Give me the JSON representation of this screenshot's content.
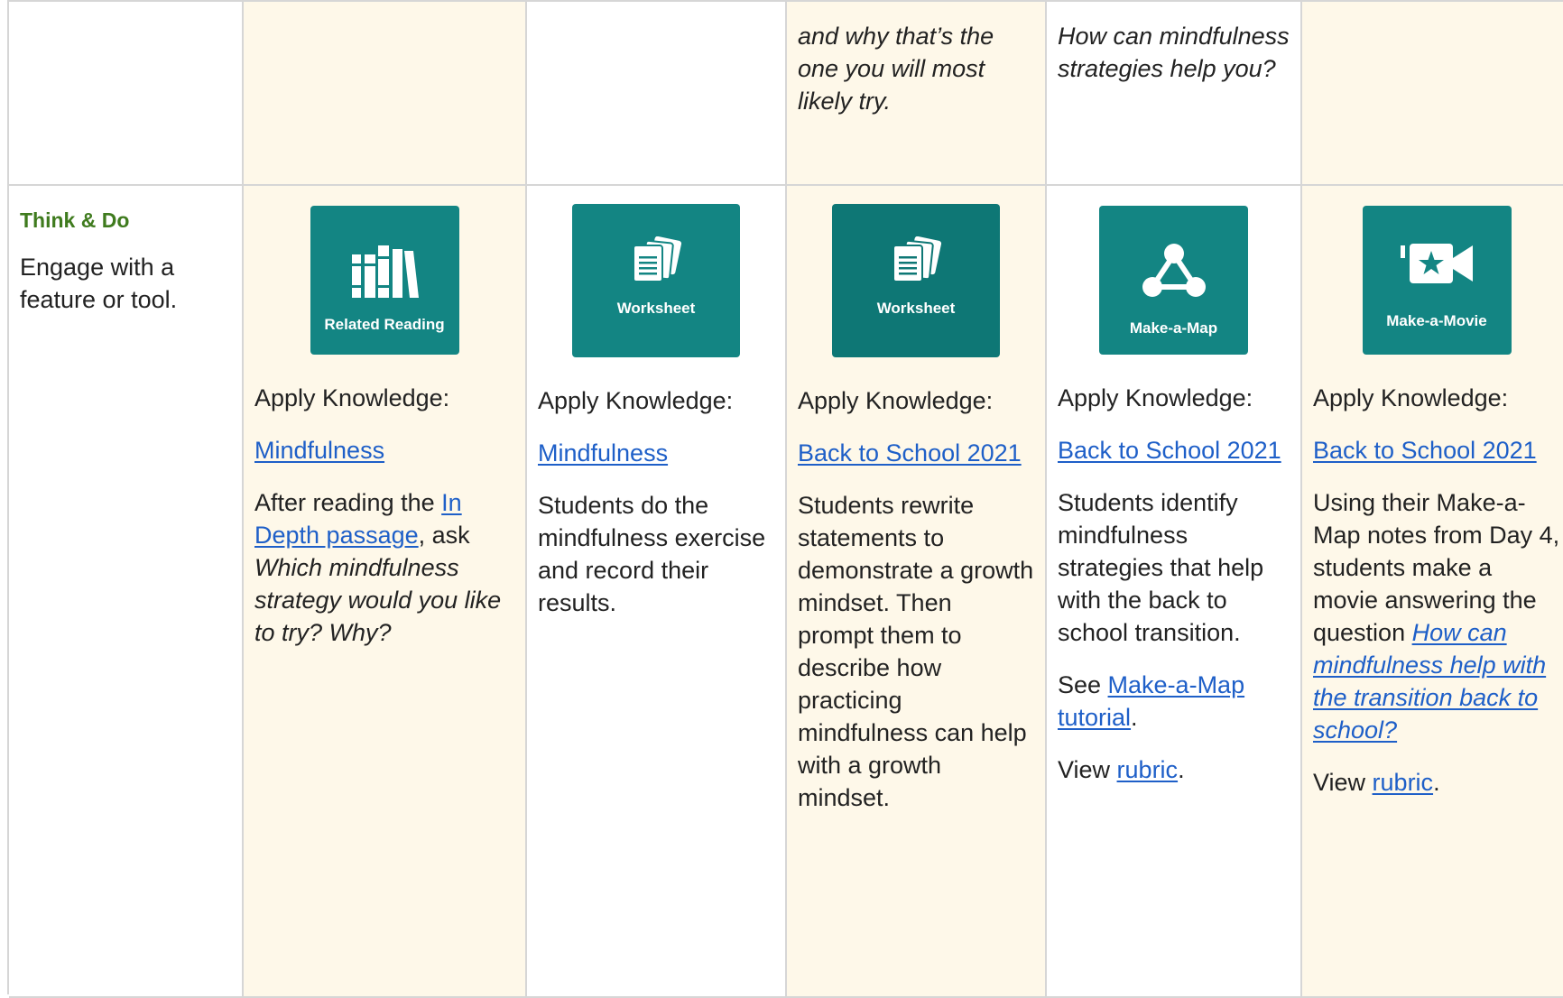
{
  "top_row": {
    "c4_text": "and why that’s the one you will most likely try.",
    "c5_text": "How can mindfulness strategies help you?"
  },
  "think_do": {
    "label": "Think & Do",
    "description": "Engage with a feature or tool."
  },
  "columns": [
    {
      "tool_name": "Related Reading",
      "icon": "books-icon",
      "apply_label": "Apply Knowledge:",
      "topic_link": "Mindfulness",
      "text_before": "After reading the ",
      "inline_link": "In Depth passage",
      "text_after": ", ask ",
      "question": "Which mindfulness strategy would you like to try? Why?"
    },
    {
      "tool_name": "Worksheet",
      "icon": "worksheet-icon",
      "apply_label": "Apply Knowledge:",
      "topic_link": "Mindfulness",
      "desc": "Students do the mindfulness exercise and record their results."
    },
    {
      "tool_name": "Worksheet",
      "icon": "worksheet-icon",
      "apply_label": "Apply Knowledge:",
      "topic_link": "Back to School 2021",
      "desc": "Students rewrite statements to demonstrate a growth mindset. Then prompt them to describe how practicing mindfulness can help with a growth mindset."
    },
    {
      "tool_name": "Make-a-Map",
      "icon": "concept-map-icon",
      "apply_label": "Apply Knowledge:",
      "topic_link": "Back to School 2021",
      "desc": "Students identify mindfulness strategies that help with the back to school transition.",
      "see_prefix": "See ",
      "see_link": "Make-a-Map tutorial",
      "see_suffix": ".",
      "view_prefix": "View ",
      "view_link": "rubric",
      "view_suffix": "."
    },
    {
      "tool_name": "Make-a-Movie",
      "icon": "movie-camera-icon",
      "apply_label": "Apply Knowledge:",
      "topic_link": "Back to School 2021",
      "desc_before": "Using their Make-a-Map notes from Day 4, students make a movie answering the question ",
      "question_link": "How can mindfulness help with the transition back to school?",
      "view_prefix": "View ",
      "view_link": "rubric",
      "view_suffix": "."
    }
  ],
  "colors": {
    "tile": "#138583",
    "link": "#1e5fc8",
    "label_green": "#3f7b1e",
    "cream": "#fef8e9",
    "border": "#d6d6d6"
  }
}
